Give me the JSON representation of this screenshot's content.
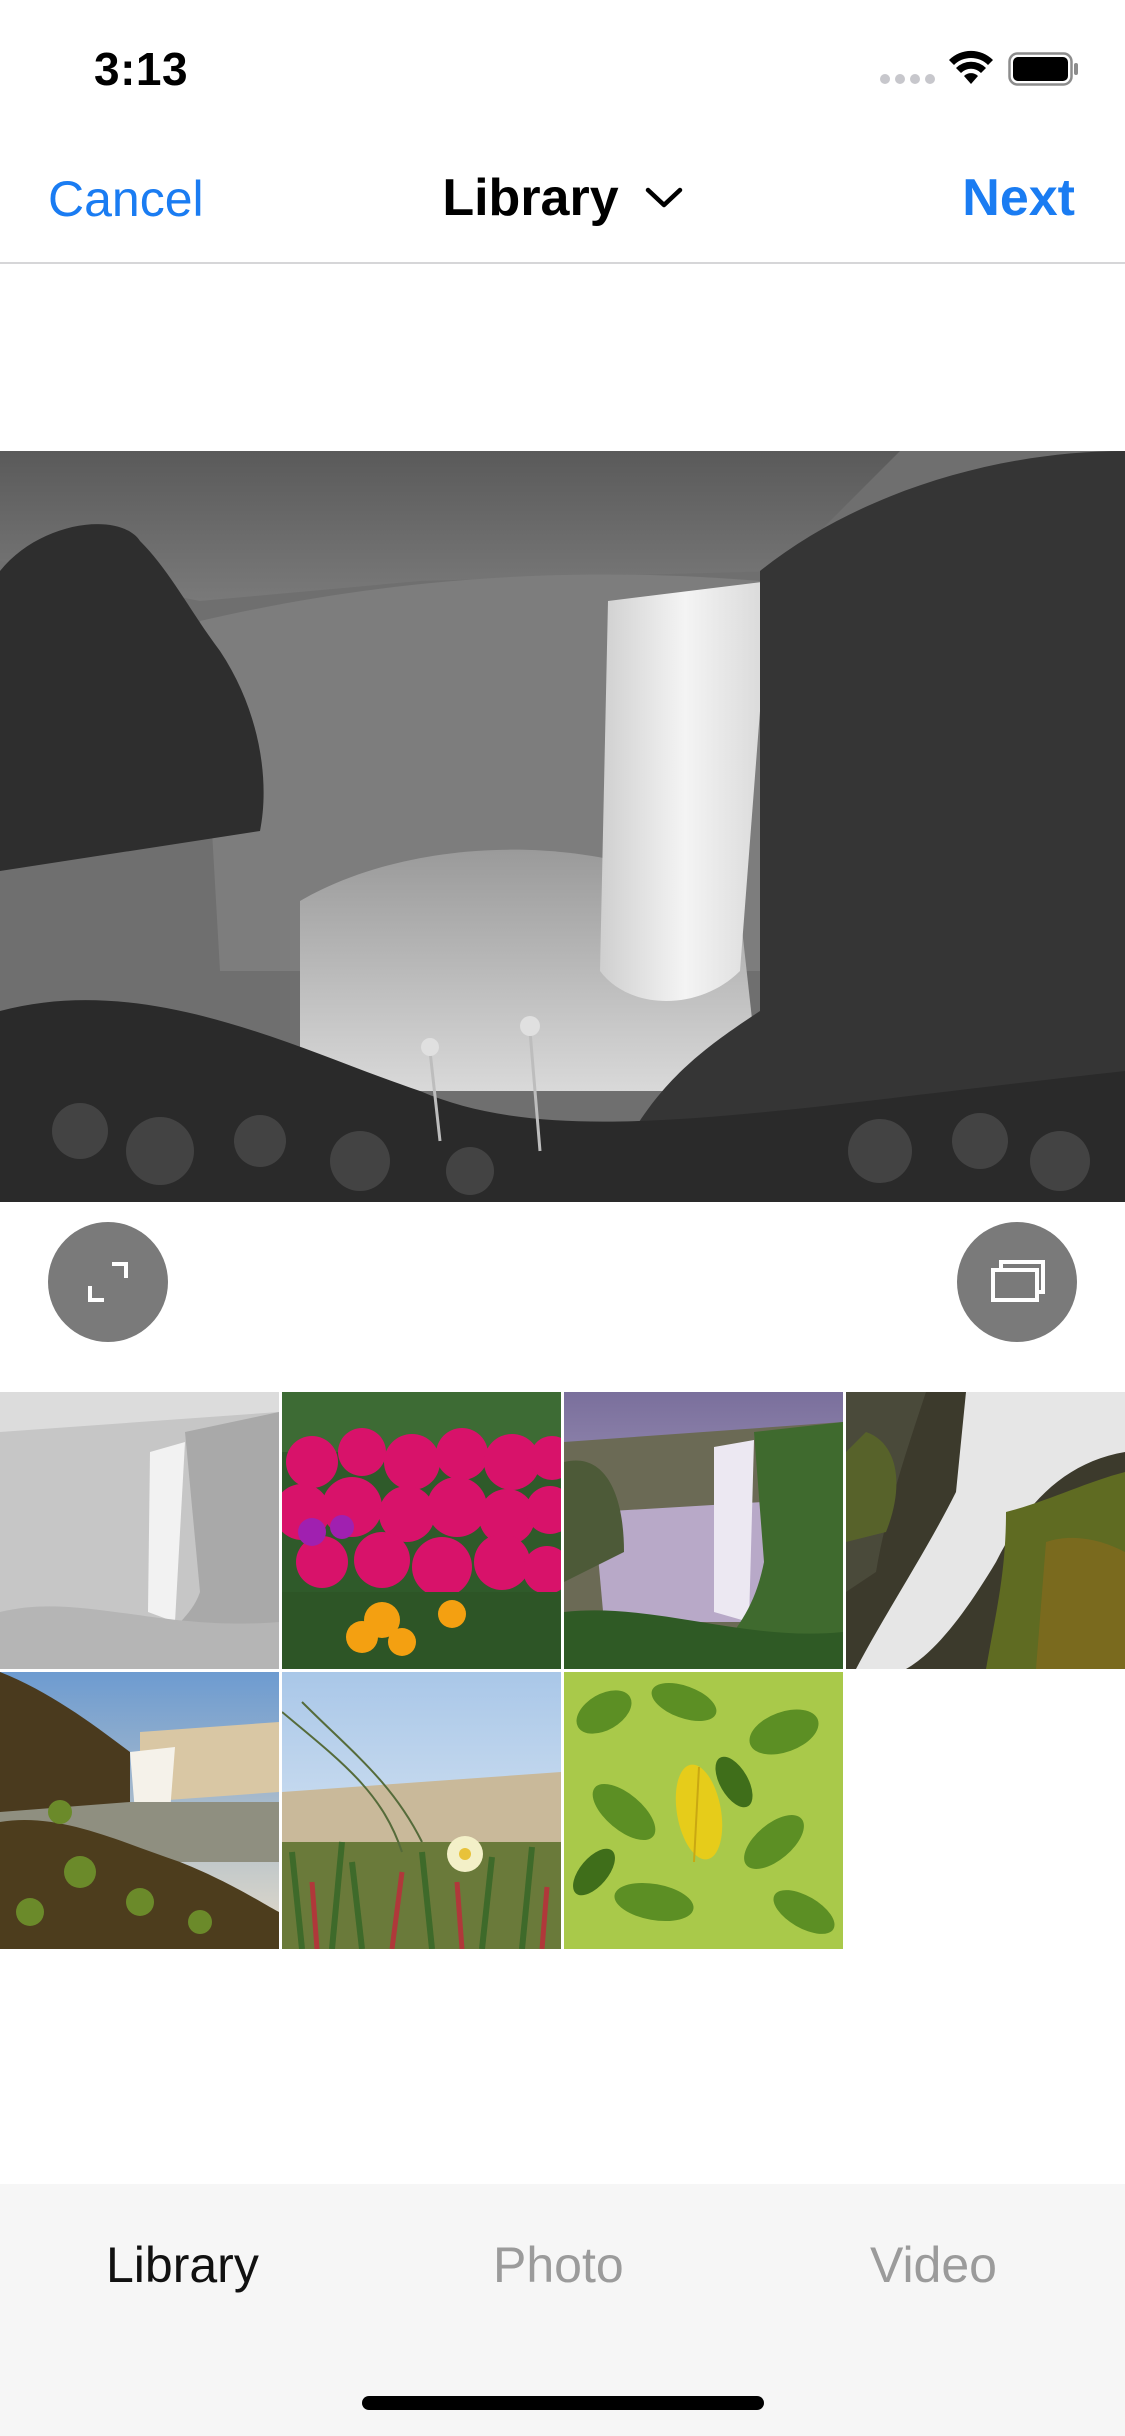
{
  "status_bar": {
    "time": "3:13",
    "icons": [
      "cellular-signal-icon",
      "wifi-icon",
      "battery-icon"
    ]
  },
  "nav": {
    "cancel_label": "Cancel",
    "title": "Library",
    "title_icon": "chevron-down-icon",
    "next_label": "Next"
  },
  "preview": {
    "subject": "black-and-white waterfall",
    "controls": [
      "expand-icon",
      "select-multiple-icon"
    ]
  },
  "thumbnails": [
    {
      "subject": "faded waterfall"
    },
    {
      "subject": "magenta flowers"
    },
    {
      "subject": "waterfall purple sky"
    },
    {
      "subject": "cascade over mossy rocks"
    },
    {
      "subject": "waterfall at rocky shore"
    },
    {
      "subject": "dune grass with flower"
    },
    {
      "subject": "green leaves with yellow leaf"
    }
  ],
  "tabs": [
    {
      "label": "Library",
      "active": true
    },
    {
      "label": "Photo",
      "active": false
    },
    {
      "label": "Video",
      "active": false
    }
  ],
  "colors": {
    "accent": "#1a7cf2",
    "tab_active": "#111111",
    "tab_inactive": "#9b9b9b",
    "tab_bar_bg": "#f6f6f6"
  }
}
